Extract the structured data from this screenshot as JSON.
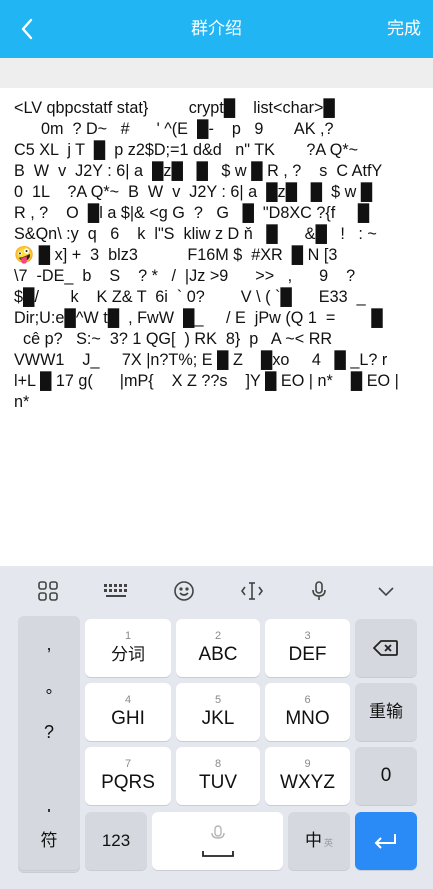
{
  "header": {
    "title": "群介绍",
    "done_label": "完成",
    "bg_color": "#21b6f3"
  },
  "content": {
    "text": "<LV qbpcstatf stat}         crypt█    list<char>█\n      0m  ? D~   #      ' ^(E  █-    p   9       AK ,?\nC5 XL  j T  █  p z2$D;=1 d&d   n\" TK       ?A Q*~\nB  W  v  J2Y : 6| a  █z█   █   $ w █ R , ?    s  C AtfY\n0  1L    ?A Q*~  B  W  v  J2Y : 6| a  █z█   █  $ w █\nR , ?    O  █l a $|& <g G  ?   G   █  \"D8XC ?{f     █\nS&Qn\\ :y  q   6    k  l\"S  kliw z D ň   █      &█   !   : ~\n🤪 █ x] +  3  blz3           F16M $  #XR  █ N [3\n\\7  -DE_  b    S    ? *   /  |Jz >9      >>   ,      9    ?\n$█/       k    K Z& T  6i  ` 0?        V \\ ( `█      E33  _\nDir;U:e█^W t█  , FwW  █_     / E  jPw (Q 1  =        █\n  cê p?   S:~  3? 1 QG[  ) RK  8}  p   A ~< RR\nVWW1    J_     7X |n?T%; E █ Z    █xo     4   █ _L? r\nl+L █ 17 g(      |mP{    X Z ??s    ]Y █ EO | n*    █ EO |\nn*"
  },
  "keyboard": {
    "toolbar": [
      "grid-icon",
      "keyboard-icon",
      "emoji-icon",
      "cursor-icon",
      "mic-icon",
      "collapse-icon"
    ],
    "symbols": [
      ",",
      "°",
      "?",
      "!"
    ],
    "keys": [
      {
        "num": "1",
        "label": "分词"
      },
      {
        "num": "2",
        "label": "ABC"
      },
      {
        "num": "3",
        "label": "DEF"
      },
      {
        "num": "4",
        "label": "GHI"
      },
      {
        "num": "5",
        "label": "JKL"
      },
      {
        "num": "6",
        "label": "MNO"
      },
      {
        "num": "7",
        "label": "PQRS"
      },
      {
        "num": "8",
        "label": "TUV"
      },
      {
        "num": "9",
        "label": "WXYZ"
      }
    ],
    "backspace_icon": "backspace-icon",
    "reenter_label": "重输",
    "zero_label": "0",
    "symbol_key_label": "符",
    "num123_label": "123",
    "space_icon": "mic-icon",
    "lang_label": "中",
    "lang_small": "英",
    "enter_icon": "enter-icon",
    "enter_color": "#2a8af6"
  }
}
